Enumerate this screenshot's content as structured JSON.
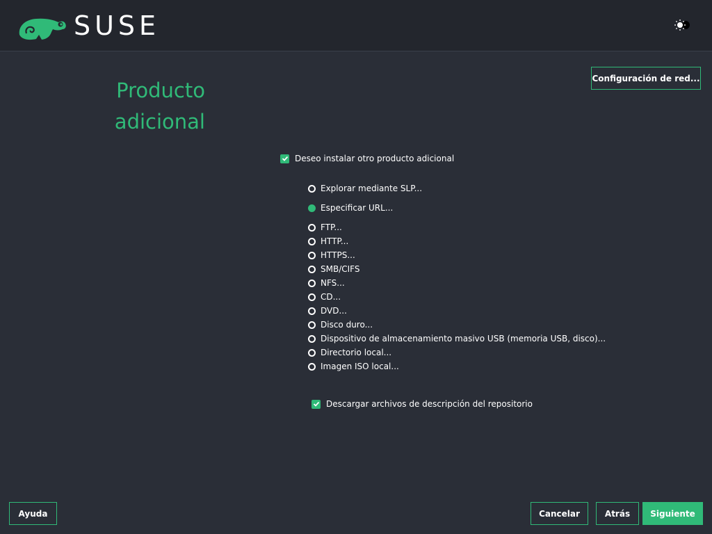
{
  "header": {
    "brand": "SUSE",
    "theme_toggle_icon": "sun-moon-icon"
  },
  "page": {
    "title_line1": "Producto",
    "title_line2": "adicional"
  },
  "network_button": "Configuración de red...",
  "install_addon_checkbox": {
    "label": "Deseo instalar otro producto adicional",
    "checked": true
  },
  "sources": [
    {
      "label": "Explorar mediante SLP...",
      "selected": false
    },
    {
      "label": "Especificar URL...",
      "selected": true
    },
    {
      "label": "FTP...",
      "selected": false
    },
    {
      "label": "HTTP...",
      "selected": false
    },
    {
      "label": "HTTPS...",
      "selected": false
    },
    {
      "label": "SMB/CIFS",
      "selected": false
    },
    {
      "label": "NFS...",
      "selected": false
    },
    {
      "label": "CD...",
      "selected": false
    },
    {
      "label": "DVD...",
      "selected": false
    },
    {
      "label": "Disco duro...",
      "selected": false
    },
    {
      "label": "Dispositivo de almacenamiento masivo USB (memoria USB, disco)...",
      "selected": false
    },
    {
      "label": "Directorio local...",
      "selected": false
    },
    {
      "label": "Imagen ISO local...",
      "selected": false
    }
  ],
  "download_descriptions_checkbox": {
    "label": "Descargar archivos de descripción del repositorio",
    "checked": true
  },
  "footer": {
    "help": "Ayuda",
    "cancel": "Cancelar",
    "back": "Atrás",
    "next": "Siguiente"
  },
  "colors": {
    "accent": "#30ba78",
    "background": "#2a2e37",
    "header": "#23262d"
  }
}
